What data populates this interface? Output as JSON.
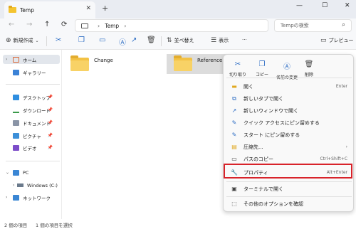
{
  "window": {
    "tab_title": "Temp",
    "tab_close": "✕",
    "new_tab": "+",
    "minimize": "—",
    "maximize": "☐",
    "close": "✕"
  },
  "address": {
    "back": "←",
    "forward": "→",
    "up": "↑",
    "refresh": "⟳",
    "crumb_sep": "›",
    "crumb": "Temp",
    "crumb_end_sep": "›",
    "search_placeholder": "Tempの検索",
    "search_icon": "⌕"
  },
  "toolbar": {
    "new_label": "新規作成",
    "new_icon": "⊕",
    "sort_label": "並べ替え",
    "sort_icon": "⇅",
    "view_label": "表示",
    "view_icon": "☰",
    "more": "···",
    "preview_label": "プレビュー",
    "preview_icon": "▭"
  },
  "sidebar": {
    "home": "ホーム",
    "gallery": "ギャラリー",
    "desktop": "デスクトップ",
    "downloads": "ダウンロード",
    "documents": "ドキュメント",
    "pictures": "ピクチャ",
    "videos": "ビデオ",
    "pc": "PC",
    "windows": "Windows (C:)",
    "network": "ネットワーク",
    "pin": "📌",
    "caret_down": "⌄",
    "caret_right": "›"
  },
  "files": [
    {
      "name": "Change"
    },
    {
      "name": "Reference"
    }
  ],
  "status": {
    "items": "2 個の項目",
    "selected": "1 個の項目を選択"
  },
  "context_menu": {
    "quick": [
      {
        "label": "切り取り",
        "icon": "✂"
      },
      {
        "label": "コピー",
        "icon": "❐"
      },
      {
        "label": "名前の変更",
        "icon": "Ⓐ"
      },
      {
        "label": "削除",
        "icon": "🗑"
      }
    ],
    "items": [
      {
        "label": "開く",
        "shortcut": "Enter",
        "icon": "▬"
      },
      {
        "label": "新しいタブで開く",
        "shortcut": "",
        "icon": "⧉"
      },
      {
        "label": "新しいウィンドウで開く",
        "shortcut": "",
        "icon": "↗"
      },
      {
        "label": "クイック アクセスにピン留めする",
        "shortcut": "",
        "icon": "✎"
      },
      {
        "label": "スタート にピン留めする",
        "shortcut": "",
        "icon": "✎"
      },
      {
        "label": "圧縮先...",
        "shortcut": "›",
        "icon": "▤"
      },
      {
        "label": "パスのコピー",
        "shortcut": "Ctrl+Shift+C",
        "icon": "▭"
      },
      {
        "label": "プロパティ",
        "shortcut": "Alt+Enter",
        "icon": "🔧"
      },
      {
        "label": "ターミナルで開く",
        "shortcut": "",
        "icon": "▣"
      },
      {
        "label": "その他のオプションを確認",
        "shortcut": "",
        "icon": "⬚"
      }
    ]
  },
  "colors": {
    "accent": "#2d6dc4",
    "highlight_box": "#d8232a",
    "folder": "#f3c245"
  }
}
